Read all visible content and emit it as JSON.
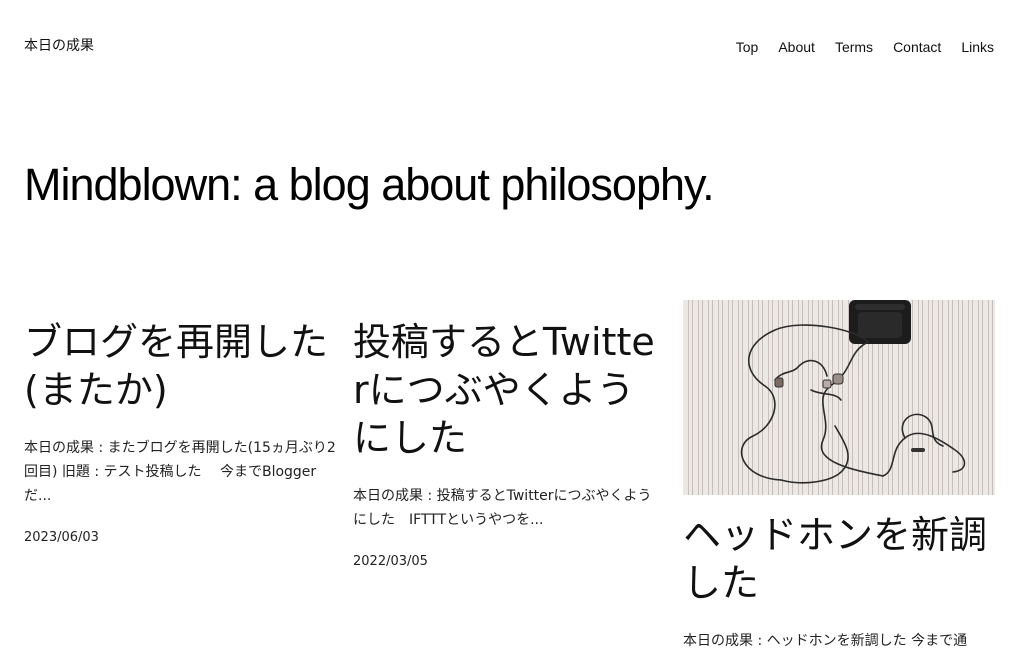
{
  "site": {
    "title": "本日の成果"
  },
  "nav": {
    "items": [
      "Top",
      "About",
      "Terms",
      "Contact",
      "Links"
    ]
  },
  "tagline": "Mindblown: a blog about philosophy.",
  "posts": [
    {
      "title": "ブログを再開した(またか)",
      "excerpt": "本日の成果 : またブログを再開した(15ヵ月ぶり2回目) 旧題 : テスト投稿した　 今までBloggerだ...",
      "date": "2023/06/03"
    },
    {
      "title": "投稿するとTwitterにつぶやくようにした",
      "excerpt": "本日の成果 : 投稿するとTwitterにつぶやくようにした　IFTTTというやつを...",
      "date": "2022/03/05"
    },
    {
      "title": "ヘッドホンを新調した",
      "excerpt": "本日の成果 : ヘッドホンを新調した 今まで通",
      "image_subject": "earphones-on-striped-bedsheet"
    }
  ]
}
